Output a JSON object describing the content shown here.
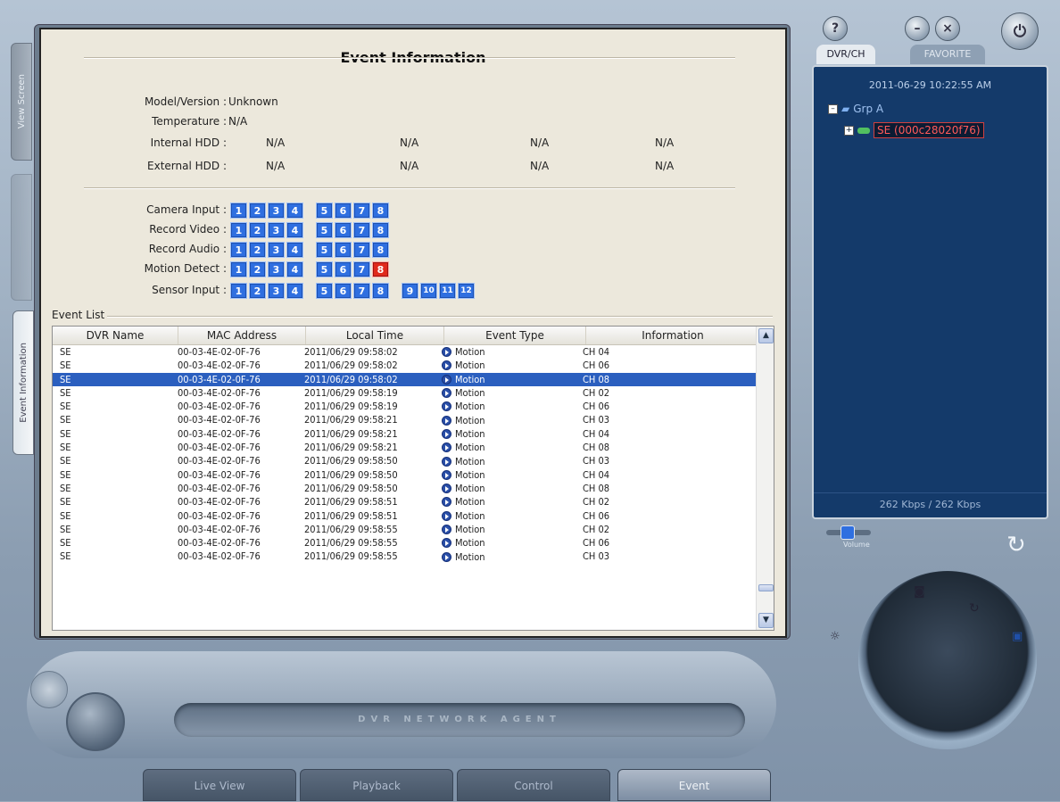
{
  "left_tabs": [
    "View Screen",
    "",
    "Event Information"
  ],
  "panel": {
    "title": "Event Information",
    "info": [
      {
        "label": "Model/Version :",
        "values": [
          "Unknown"
        ]
      },
      {
        "label": "Temperature :",
        "values": [
          "N/A"
        ]
      },
      {
        "label": "Internal HDD :",
        "values": [
          "N/A",
          "N/A",
          "N/A",
          "N/A"
        ]
      },
      {
        "label": "External HDD :",
        "values": [
          "N/A",
          "N/A",
          "N/A",
          "N/A"
        ]
      }
    ],
    "channels": [
      {
        "label": "Camera Input :",
        "groups": [
          [
            "1",
            "2",
            "3",
            "4"
          ],
          [
            "5",
            "6",
            "7",
            "8"
          ]
        ],
        "alert": []
      },
      {
        "label": "Record Video :",
        "groups": [
          [
            "1",
            "2",
            "3",
            "4"
          ],
          [
            "5",
            "6",
            "7",
            "8"
          ]
        ],
        "alert": []
      },
      {
        "label": "Record Audio :",
        "groups": [
          [
            "1",
            "2",
            "3",
            "4"
          ],
          [
            "5",
            "6",
            "7",
            "8"
          ]
        ],
        "alert": []
      },
      {
        "label": "Motion Detect :",
        "groups": [
          [
            "1",
            "2",
            "3",
            "4"
          ],
          [
            "5",
            "6",
            "7",
            "8"
          ]
        ],
        "alert": [
          "8"
        ]
      },
      {
        "label": "Sensor Input :",
        "groups": [
          [
            "1",
            "2",
            "3",
            "4"
          ],
          [
            "5",
            "6",
            "7",
            "8"
          ],
          [
            "9",
            "10",
            "11",
            "12"
          ]
        ],
        "alert": []
      }
    ],
    "event_list_label": "Event List",
    "columns": [
      "DVR Name",
      "MAC Address",
      "Local Time",
      "Event Type",
      "Information"
    ],
    "rows": [
      {
        "dvr": "SE",
        "mac": "00-03-4E-02-0F-76",
        "time": "2011/06/29 09:58:02",
        "type": "Motion",
        "info": "CH 04",
        "selected": false
      },
      {
        "dvr": "SE",
        "mac": "00-03-4E-02-0F-76",
        "time": "2011/06/29 09:58:02",
        "type": "Motion",
        "info": "CH 06",
        "selected": false
      },
      {
        "dvr": "SE",
        "mac": "00-03-4E-02-0F-76",
        "time": "2011/06/29 09:58:02",
        "type": "Motion",
        "info": "CH 08",
        "selected": true
      },
      {
        "dvr": "SE",
        "mac": "00-03-4E-02-0F-76",
        "time": "2011/06/29 09:58:19",
        "type": "Motion",
        "info": "CH 02",
        "selected": false
      },
      {
        "dvr": "SE",
        "mac": "00-03-4E-02-0F-76",
        "time": "2011/06/29 09:58:19",
        "type": "Motion",
        "info": "CH 06",
        "selected": false
      },
      {
        "dvr": "SE",
        "mac": "00-03-4E-02-0F-76",
        "time": "2011/06/29 09:58:21",
        "type": "Motion",
        "info": "CH 03",
        "selected": false
      },
      {
        "dvr": "SE",
        "mac": "00-03-4E-02-0F-76",
        "time": "2011/06/29 09:58:21",
        "type": "Motion",
        "info": "CH 04",
        "selected": false
      },
      {
        "dvr": "SE",
        "mac": "00-03-4E-02-0F-76",
        "time": "2011/06/29 09:58:21",
        "type": "Motion",
        "info": "CH 08",
        "selected": false
      },
      {
        "dvr": "SE",
        "mac": "00-03-4E-02-0F-76",
        "time": "2011/06/29 09:58:50",
        "type": "Motion",
        "info": "CH 03",
        "selected": false
      },
      {
        "dvr": "SE",
        "mac": "00-03-4E-02-0F-76",
        "time": "2011/06/29 09:58:50",
        "type": "Motion",
        "info": "CH 04",
        "selected": false
      },
      {
        "dvr": "SE",
        "mac": "00-03-4E-02-0F-76",
        "time": "2011/06/29 09:58:50",
        "type": "Motion",
        "info": "CH 08",
        "selected": false
      },
      {
        "dvr": "SE",
        "mac": "00-03-4E-02-0F-76",
        "time": "2011/06/29 09:58:51",
        "type": "Motion",
        "info": "CH 02",
        "selected": false
      },
      {
        "dvr": "SE",
        "mac": "00-03-4E-02-0F-76",
        "time": "2011/06/29 09:58:51",
        "type": "Motion",
        "info": "CH 06",
        "selected": false
      },
      {
        "dvr": "SE",
        "mac": "00-03-4E-02-0F-76",
        "time": "2011/06/29 09:58:55",
        "type": "Motion",
        "info": "CH 02",
        "selected": false
      },
      {
        "dvr": "SE",
        "mac": "00-03-4E-02-0F-76",
        "time": "2011/06/29 09:58:55",
        "type": "Motion",
        "info": "CH 06",
        "selected": false
      },
      {
        "dvr": "SE",
        "mac": "00-03-4E-02-0F-76",
        "time": "2011/06/29 09:58:55",
        "type": "Motion",
        "info": "CH 03",
        "selected": false
      }
    ]
  },
  "right": {
    "tabs": [
      "DVR/CH",
      "FAVORITE"
    ],
    "datetime": "2011-06-29 10:22:55 AM",
    "group": "Grp A",
    "device": "SE (000c28020f76)",
    "bitrate": "262 Kbps / 262 Kbps",
    "volume_label": "Volume"
  },
  "bottom": {
    "brand": "DVR NETWORK AGENT",
    "tabs": [
      "Live View",
      "Playback",
      "Control",
      "Event"
    ],
    "active_tab": "Event"
  },
  "colors": {
    "channel_on": "#2f6fe0",
    "channel_alert": "#e02a1c",
    "selection": "#2b5fbf",
    "tree_bg": "#143a6a"
  }
}
